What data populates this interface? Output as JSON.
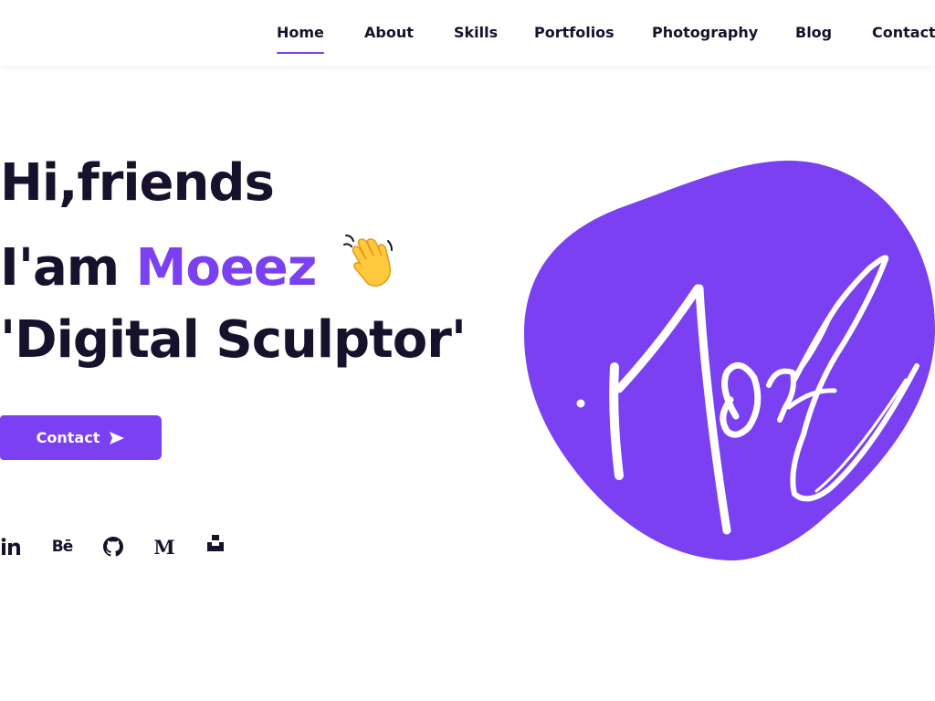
{
  "colors": {
    "accent": "#7a40f2",
    "text_dark": "#17112b",
    "background": "#ffffff"
  },
  "nav": {
    "items": [
      {
        "label": "Home",
        "active": true
      },
      {
        "label": "About"
      },
      {
        "label": "Skills"
      },
      {
        "label": "Portfolios"
      },
      {
        "label": "Photography"
      },
      {
        "label": "Blog"
      },
      {
        "label": "Contact"
      }
    ]
  },
  "hero": {
    "line1": "Hi,friends",
    "line2_prefix": "I'am ",
    "name": "Moeez",
    "wave_icon": "waving-hand-icon",
    "line3": "'Digital Sculptor'"
  },
  "contact_button": {
    "label": "Contact",
    "icon": "send-icon"
  },
  "socials": [
    {
      "name": "linkedin",
      "glyph": "in"
    },
    {
      "name": "behance",
      "glyph": "Bē"
    },
    {
      "name": "github",
      "icon": "github-icon"
    },
    {
      "name": "medium",
      "glyph": "M"
    },
    {
      "name": "unsplash",
      "icon": "unsplash-icon"
    }
  ],
  "logo": {
    "icon": "signature-logo-icon"
  }
}
